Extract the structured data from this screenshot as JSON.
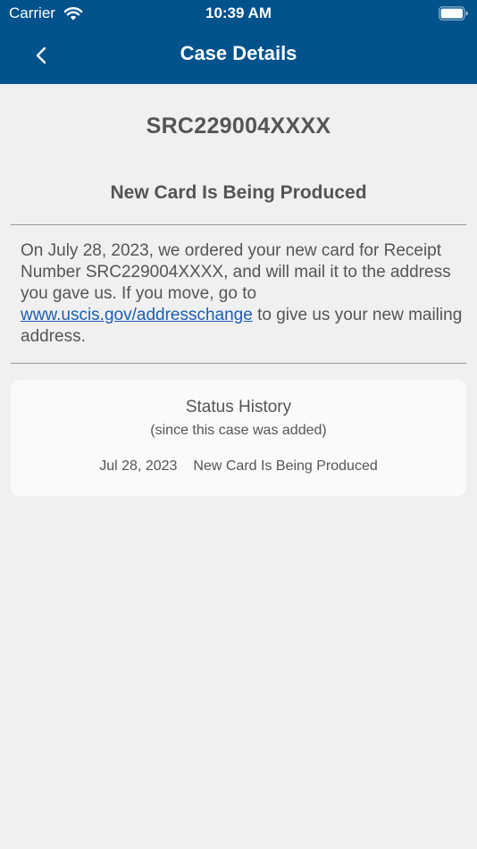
{
  "status_bar": {
    "carrier": "Carrier",
    "time": "10:39 AM"
  },
  "nav": {
    "title": "Case Details",
    "back_icon": "chevron-left-icon"
  },
  "case": {
    "receipt_number": "SRC229004XXXX",
    "status_title": "New Card Is Being Produced",
    "description_before_link": "On July 28, 2023, we ordered your new card for Receipt Number SRC229004XXXX, and will mail it to the address you gave us. If you move, go to ",
    "description_link": "www.uscis.gov/addresschange",
    "description_after_link": " to give us your new mailing address."
  },
  "history": {
    "title": "Status History",
    "subtitle": "(since this case was added)",
    "entries": [
      {
        "date": "Jul 28, 2023",
        "status": "New Card Is Being Produced"
      }
    ]
  },
  "colors": {
    "header": "#02528c",
    "background": "#f0f0f0",
    "link": "#1a5fb4"
  }
}
